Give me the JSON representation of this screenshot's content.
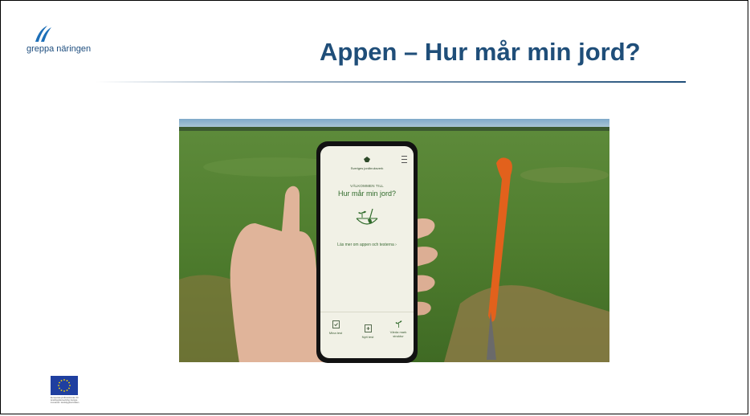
{
  "header": {
    "logo_text": "greppa näringen",
    "title": "Appen – Hur mår min jord?"
  },
  "phone_app": {
    "brand_text": "Sveriges jordbruksverk",
    "welcome": "VÄLKOMMEN TILL",
    "app_title": "Hur mår min jord?",
    "link": "Läs mer om appen och testerna ›",
    "nav": [
      {
        "label": "Mina test",
        "icon": "clipboard-check-icon"
      },
      {
        "label": "Nytt test",
        "icon": "clipboard-plus-icon"
      },
      {
        "label": "Värda mark struktur",
        "icon": "sprout-icon"
      }
    ]
  },
  "footer": {
    "eu_caption": "Europeiska jordbruksfonden för landsbygdsutveckling: Europa investerar i landsbygdsområden"
  },
  "colors": {
    "title": "#1f4e79",
    "app_green": "#2f6a2a",
    "eu_blue": "#1f3fa0",
    "eu_star": "#ffdd00"
  }
}
